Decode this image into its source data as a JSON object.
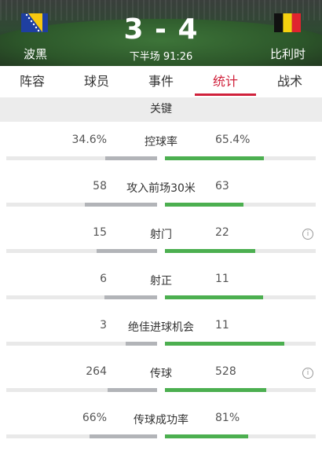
{
  "match": {
    "home_team": "波黑",
    "away_team": "比利时",
    "score": "3 - 4",
    "period_time": "下半场 91:26"
  },
  "tabs": [
    {
      "label": "阵容",
      "active": false
    },
    {
      "label": "球员",
      "active": false
    },
    {
      "label": "事件",
      "active": false
    },
    {
      "label": "统计",
      "active": true
    },
    {
      "label": "战术",
      "active": false
    }
  ],
  "section": {
    "title": "关键"
  },
  "colors": {
    "accent": "#d0213b",
    "home_bar": "#b2b4b8",
    "away_bar": "#4caf50"
  },
  "stats": [
    {
      "label": "控球率",
      "home": "34.6%",
      "away": "65.4%",
      "home_frac": 0.346,
      "away_frac": 0.654,
      "info": false
    },
    {
      "label": "攻入前场30米",
      "home": "58",
      "away": "63",
      "home_frac": 0.48,
      "away_frac": 0.52,
      "info": true
    },
    {
      "label": "射门",
      "home": "15",
      "away": "22",
      "home_frac": 0.4,
      "away_frac": 0.6,
      "info": false
    },
    {
      "label": "射正",
      "home": "6",
      "away": "11",
      "home_frac": 0.35,
      "away_frac": 0.65,
      "info": false
    },
    {
      "label": "绝佳进球机会",
      "home": "3",
      "away": "11",
      "home_frac": 0.21,
      "away_frac": 0.79,
      "info": true
    },
    {
      "label": "传球",
      "home": "264",
      "away": "528",
      "home_frac": 0.33,
      "away_frac": 0.67,
      "info": false
    },
    {
      "label": "传球成功率",
      "home": "66%",
      "away": "81%",
      "home_frac": 0.45,
      "away_frac": 0.55,
      "info": false
    }
  ]
}
